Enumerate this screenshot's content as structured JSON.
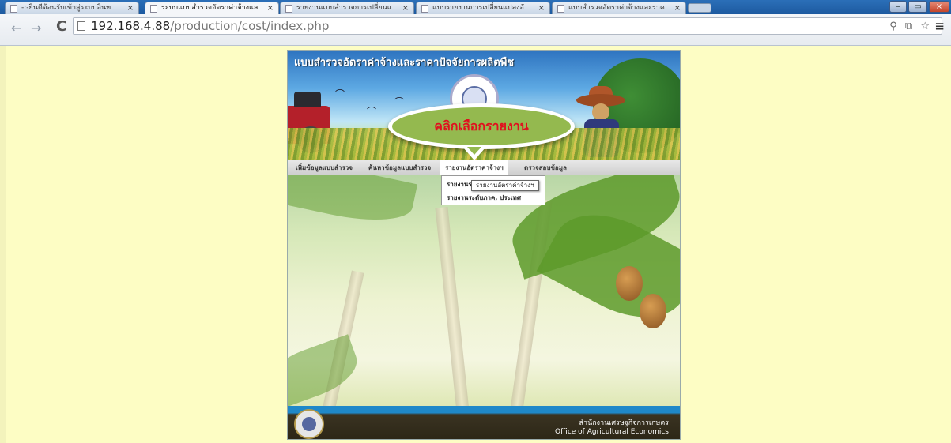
{
  "browser": {
    "tabs": [
      {
        "title": "-:-ยินดีต้อนรับเข้าสู่ระบบอินท",
        "active": false
      },
      {
        "title": "ระบบแบบสำรวจอัตราค่าจ้างแล",
        "active": true
      },
      {
        "title": "รายงานแบบสำรวจการเปลี่ยนแ",
        "active": false
      },
      {
        "title": "แบบรายงานการเปลี่ยนแปลงอั",
        "active": false
      },
      {
        "title": "แบบสำรวจอัตราค่าจ้างและราค",
        "active": false
      }
    ],
    "tab_close": "×",
    "window_controls": {
      "minimize": "–",
      "restore": "▭",
      "close": "×"
    },
    "back": "←",
    "forward": "→",
    "reload": "C",
    "address": {
      "host": "192.168.4.88",
      "path": "/production/cost/index.php"
    },
    "tools": "⚲ ⧉ ☆",
    "menu_icon": "≡"
  },
  "site": {
    "banner_title": "แบบสำรวจอัตราค่าจ้างและราคาปัจจัยการผลิตพืช",
    "bubble_text": "คลิกเลือกรายงาน",
    "nav": [
      {
        "label": "เพิ่มข้อมูลแบบสำรวจ"
      },
      {
        "label": "ค้นหาข้อมูลแบบสำรวจ"
      },
      {
        "label": "รายงานอัตราค่าจ้างฯ"
      },
      {
        "label": "ตรวจสอบข้อมูล"
      }
    ],
    "dropdown": [
      {
        "label": "รายงานระ"
      },
      {
        "label": "รายงานระดับภาค, ประเทศ"
      }
    ],
    "tooltip": "รายงานอัตราค่าจ้างฯ",
    "footer": {
      "thai": "สำนักงานเศรษฐกิจการเกษตร",
      "english": "Office of Agricultural Economics"
    }
  },
  "colors": {
    "page_bg": "#fdfdc4",
    "bubble": "#94b94f",
    "bubble_text": "#e0101e",
    "chrome_blue": "#2b6fb8"
  }
}
